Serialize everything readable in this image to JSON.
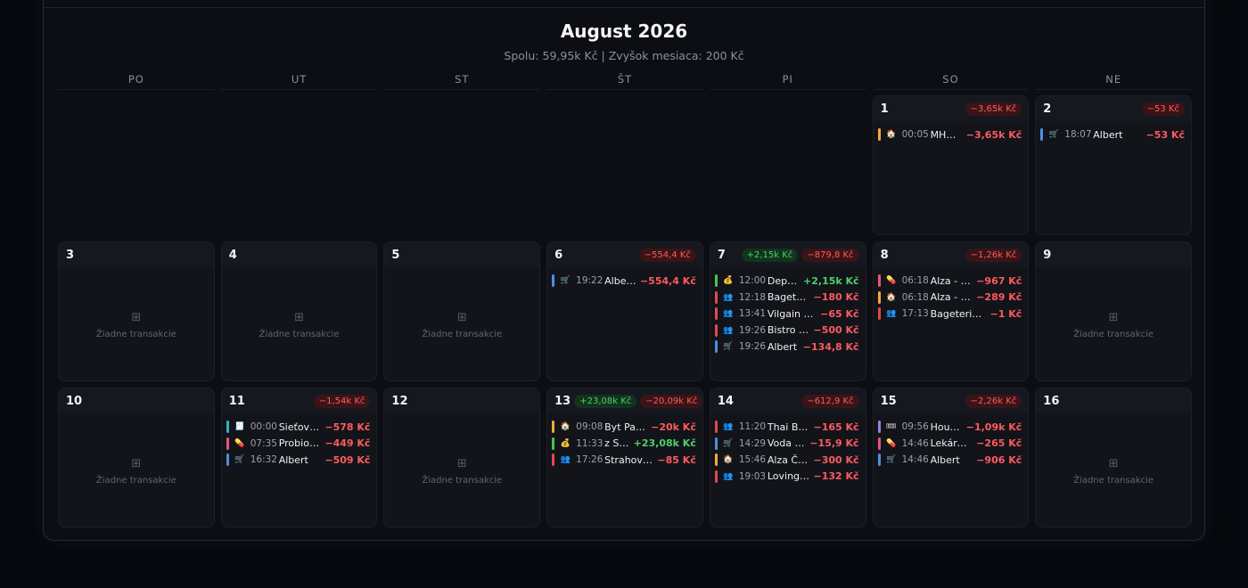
{
  "calendar": {
    "title": "August 2026",
    "subtitle": "Spolu: 59,95k Kč | Zvyšok mesiaca: 200 Kč",
    "weekdays": [
      "PO",
      "UT",
      "ST",
      "ŠT",
      "PI",
      "SO",
      "NE"
    ],
    "no_tx_label": "Žiadne transakcie",
    "no_tx_icon": "plus-square-icon"
  },
  "category_colors": {
    "transport": "#f2a93b",
    "groceries": "#4a90e2",
    "dining": "#e5484d",
    "income": "#46c35a",
    "health": "#e8557a",
    "utilities": "#2fb4c8",
    "entertainment": "#9b7fe0"
  },
  "days": [
    {
      "slot": 6,
      "num": "1",
      "badges": [
        {
          "type": "neg",
          "text": "−3,65k Kč"
        }
      ],
      "tx": [
        {
          "cat": "transport",
          "icon": "🏠",
          "time": "00:05",
          "name": "MHD lístok",
          "amt": "−3,65k Kč",
          "type": "neg"
        }
      ]
    },
    {
      "slot": 7,
      "num": "2",
      "badges": [
        {
          "type": "neg",
          "text": "−53 Kč"
        }
      ],
      "tx": [
        {
          "cat": "groceries",
          "icon": "🛒",
          "time": "18:07",
          "name": "Albert",
          "amt": "−53 Kč",
          "type": "neg"
        }
      ]
    },
    {
      "slot": 8,
      "num": "3",
      "badges": [],
      "tx": []
    },
    {
      "slot": 9,
      "num": "4",
      "badges": [],
      "tx": []
    },
    {
      "slot": 10,
      "num": "5",
      "badges": [],
      "tx": []
    },
    {
      "slot": 11,
      "num": "6",
      "badges": [
        {
          "type": "neg",
          "text": "−554,4 Kč"
        }
      ],
      "tx": [
        {
          "cat": "groceries",
          "icon": "🛒",
          "time": "19:22",
          "name": "Albert – nákup",
          "amt": "−554,4 Kč",
          "type": "neg"
        }
      ]
    },
    {
      "slot": 12,
      "num": "7",
      "badges": [
        {
          "type": "pos",
          "text": "+2,15k Kč"
        },
        {
          "type": "neg",
          "text": "−879,8 Kč"
        }
      ],
      "tx": [
        {
          "cat": "income",
          "icon": "💰",
          "time": "12:00",
          "name": "Depozit vklad",
          "amt": "+2,15k Kč",
          "type": "pos"
        },
        {
          "cat": "dining",
          "icon": "👥",
          "time": "12:18",
          "name": "Bageterie Boulevard",
          "amt": "−180 Kč",
          "type": "neg"
        },
        {
          "cat": "dining",
          "icon": "👥",
          "time": "13:41",
          "name": "Vilgain Mlieko",
          "amt": "−65 Kč",
          "type": "neg"
        },
        {
          "cat": "dining",
          "icon": "👥",
          "time": "19:26",
          "name": "Bistro Palacký",
          "amt": "−500 Kč",
          "type": "neg"
        },
        {
          "cat": "groceries",
          "icon": "🛒",
          "time": "19:26",
          "name": "Albert",
          "amt": "−134,8 Kč",
          "type": "neg"
        }
      ]
    },
    {
      "slot": 13,
      "num": "8",
      "badges": [
        {
          "type": "neg",
          "text": "−1,26k Kč"
        }
      ],
      "tx": [
        {
          "cat": "health",
          "icon": "💊",
          "time": "06:18",
          "name": "Alza - Lieky",
          "amt": "−967 Kč",
          "type": "neg"
        },
        {
          "cat": "transport",
          "icon": "🏠",
          "time": "06:18",
          "name": "Alza - Potraviny",
          "amt": "−289 Kč",
          "type": "neg"
        },
        {
          "cat": "dining",
          "icon": "👥",
          "time": "17:13",
          "name": "Bageterie Boulevard",
          "amt": "−1 Kč",
          "type": "neg"
        }
      ]
    },
    {
      "slot": 14,
      "num": "9",
      "badges": [],
      "tx": []
    },
    {
      "slot": 15,
      "num": "10",
      "badges": [],
      "tx": []
    },
    {
      "slot": 16,
      "num": "11",
      "badges": [
        {
          "type": "neg",
          "text": "−1,54k Kč"
        }
      ],
      "tx": [
        {
          "cat": "utilities",
          "icon": "🧾",
          "time": "00:00",
          "name": "Sieťová karta",
          "amt": "−578 Kč",
          "type": "neg"
        },
        {
          "cat": "health",
          "icon": "💊",
          "time": "07:35",
          "name": "Probiotiká lekáreň",
          "amt": "−449 Kč",
          "type": "neg"
        },
        {
          "cat": "groceries",
          "icon": "🛒",
          "time": "16:32",
          "name": "Albert",
          "amt": "−509 Kč",
          "type": "neg"
        }
      ]
    },
    {
      "slot": 17,
      "num": "12",
      "badges": [],
      "tx": []
    },
    {
      "slot": 18,
      "num": "13",
      "badges": [
        {
          "type": "pos",
          "text": "+23,08k Kč"
        },
        {
          "type": "neg",
          "text": "−20,09k Kč"
        }
      ],
      "tx": [
        {
          "cat": "transport",
          "icon": "🏠",
          "time": "09:08",
          "name": "Byt Pankrác",
          "amt": "−20k Kč",
          "type": "neg"
        },
        {
          "cat": "income",
          "icon": "💰",
          "time": "11:33",
          "name": "z SVK účtu",
          "amt": "+23,08k Kč",
          "type": "pos"
        },
        {
          "cat": "dining",
          "icon": "👥",
          "time": "17:26",
          "name": "Strahov študenti",
          "amt": "−85 Kč",
          "type": "neg"
        }
      ]
    },
    {
      "slot": 19,
      "num": "14",
      "badges": [
        {
          "type": "neg",
          "text": "−612,9 Kč"
        }
      ],
      "tx": [
        {
          "cat": "dining",
          "icon": "👥",
          "time": "11:20",
          "name": "Thai Bistro",
          "amt": "−165 Kč",
          "type": "neg"
        },
        {
          "cat": "groceries",
          "icon": "🛒",
          "time": "14:29",
          "name": "Voda perlivá",
          "amt": "−15,9 Kč",
          "type": "neg"
        },
        {
          "cat": "transport",
          "icon": "🏠",
          "time": "15:46",
          "name": "Alza Členstvo",
          "amt": "−300 Kč",
          "type": "neg"
        },
        {
          "cat": "dining",
          "icon": "👥",
          "time": "19:03",
          "name": "Loving Hut",
          "amt": "−132 Kč",
          "type": "neg"
        }
      ]
    },
    {
      "slot": 20,
      "num": "15",
      "badges": [
        {
          "type": "neg",
          "text": "−2,26k Kč"
        }
      ],
      "tx": [
        {
          "cat": "entertainment",
          "icon": "🎟",
          "time": "09:56",
          "name": "Hourvarka Kino",
          "amt": "−1,09k Kč",
          "type": "neg"
        },
        {
          "cat": "health",
          "icon": "💊",
          "time": "14:46",
          "name": "Lekáreň - Dr.Max",
          "amt": "−265 Kč",
          "type": "neg"
        },
        {
          "cat": "groceries",
          "icon": "🛒",
          "time": "14:46",
          "name": "Albert",
          "amt": "−906 Kč",
          "type": "neg"
        }
      ]
    },
    {
      "slot": 21,
      "num": "16",
      "badges": [],
      "tx": []
    }
  ]
}
